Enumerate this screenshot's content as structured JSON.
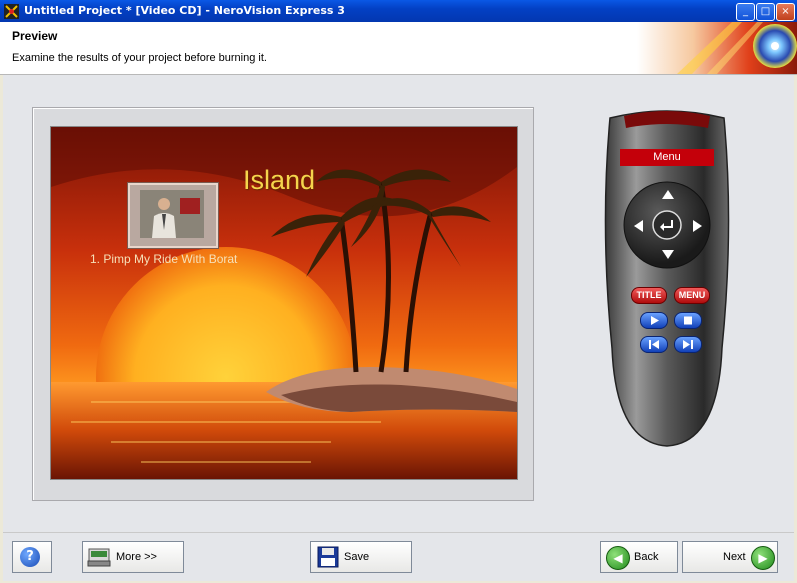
{
  "window": {
    "title": "Untitled Project * [Video CD] - NeroVision Express 3",
    "controls": [
      "minimize-icon",
      "maximize-icon",
      "close-icon"
    ]
  },
  "header": {
    "title": "Preview",
    "subtitle": "Examine the results of your project before burning it."
  },
  "preview": {
    "menu_title": "Island",
    "items": [
      {
        "label": "1. Pimp My Ride With Borat"
      }
    ]
  },
  "remote": {
    "display_label": "Menu",
    "buttons": {
      "title": "TITLE",
      "menu": "MENU"
    },
    "icons": [
      "up-arrow-icon",
      "down-arrow-icon",
      "left-arrow-icon",
      "right-arrow-icon",
      "enter-icon",
      "play-icon",
      "stop-icon",
      "previous-icon",
      "next-icon"
    ]
  },
  "footer": {
    "help_label": "?",
    "more_label": "More >>",
    "save_label": "Save",
    "back_label": "Back",
    "next_label": "Next"
  },
  "colors": {
    "titlebar": "#0340c4",
    "menu_title": "#f5d44c",
    "remote_red": "#c4000a",
    "remote_blue": "#1140b8",
    "go_green": "#1f8a1a"
  }
}
